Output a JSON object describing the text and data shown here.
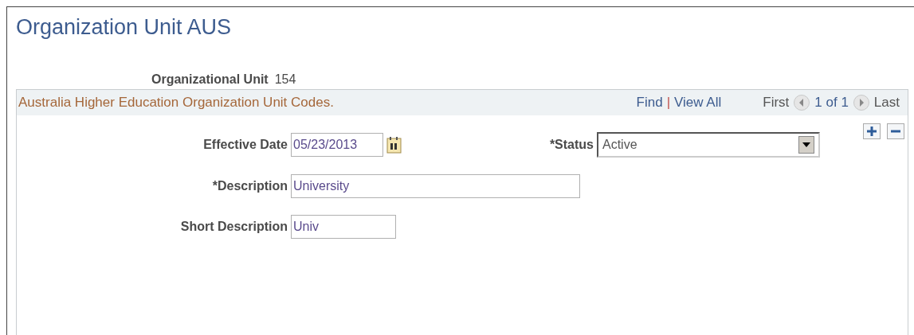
{
  "page": {
    "title": "Organization Unit AUS"
  },
  "org_unit": {
    "label": "Organizational Unit",
    "value": "154"
  },
  "section": {
    "title": "Australia Higher Education Organization Unit Codes.",
    "find": "Find",
    "separator": "|",
    "view_all": "View All",
    "first": "First",
    "count": "1 of 1",
    "last": "Last"
  },
  "fields": [
    {
      "kind": "date",
      "label": "Effective Date",
      "value": "05/23/2013"
    },
    {
      "kind": "select",
      "label": "*Status",
      "value": "Active"
    },
    {
      "kind": "text",
      "label": "*Description",
      "value": "University"
    },
    {
      "kind": "short",
      "label": "Short Description",
      "value": "Univ"
    }
  ]
}
